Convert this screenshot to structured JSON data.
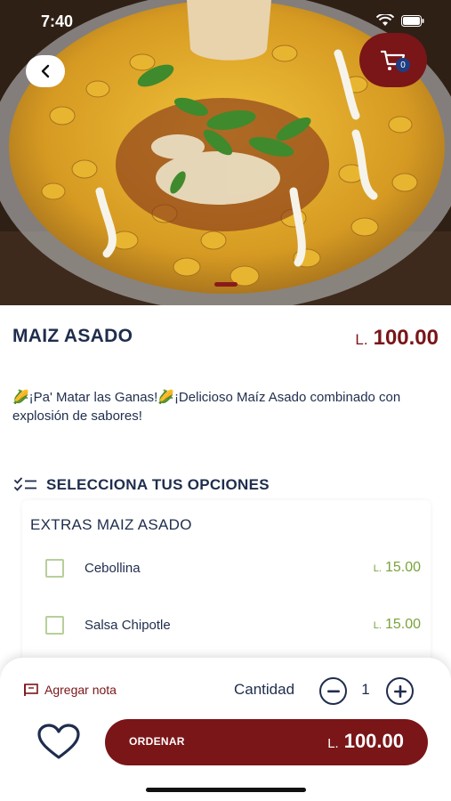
{
  "status_bar": {
    "time": "7:40"
  },
  "hero": {
    "image_alt": "Maiz asado bowl"
  },
  "cart": {
    "count": "0"
  },
  "product": {
    "title": "MAIZ ASADO",
    "currency": "L.",
    "price": "100.00",
    "description": "🌽¡Pa' Matar las Ganas!🌽¡Delicioso Maíz Asado combinado con explosión de sabores!"
  },
  "options": {
    "header": "SELECCIONA TUS OPCIONES",
    "groups": [
      {
        "title": "EXTRAS MAIZ ASADO",
        "items": [
          {
            "label": "Cebollina",
            "currency": "L.",
            "price": "15.00",
            "checked": false
          },
          {
            "label": "Salsa Chipotle",
            "currency": "L.",
            "price": "15.00",
            "checked": false
          }
        ]
      }
    ]
  },
  "footer": {
    "note_label": "Agregar nota",
    "quantity_label": "Cantidad",
    "quantity": "1",
    "order_label": "ORDENAR",
    "order_currency": "L.",
    "order_price": "100.00"
  },
  "colors": {
    "brand": "#7a1518",
    "navy": "#1f2d4d",
    "option_price": "#7aa33a",
    "checkbox_border": "#b7cf9a",
    "badge": "#1e3d82"
  },
  "icons": {
    "back": "chevron-left-icon",
    "cart": "cart-icon",
    "options": "checklist-icon",
    "note": "note-flag-icon",
    "minus": "minus-circle-icon",
    "plus": "plus-circle-icon",
    "favorite": "heart-icon"
  }
}
